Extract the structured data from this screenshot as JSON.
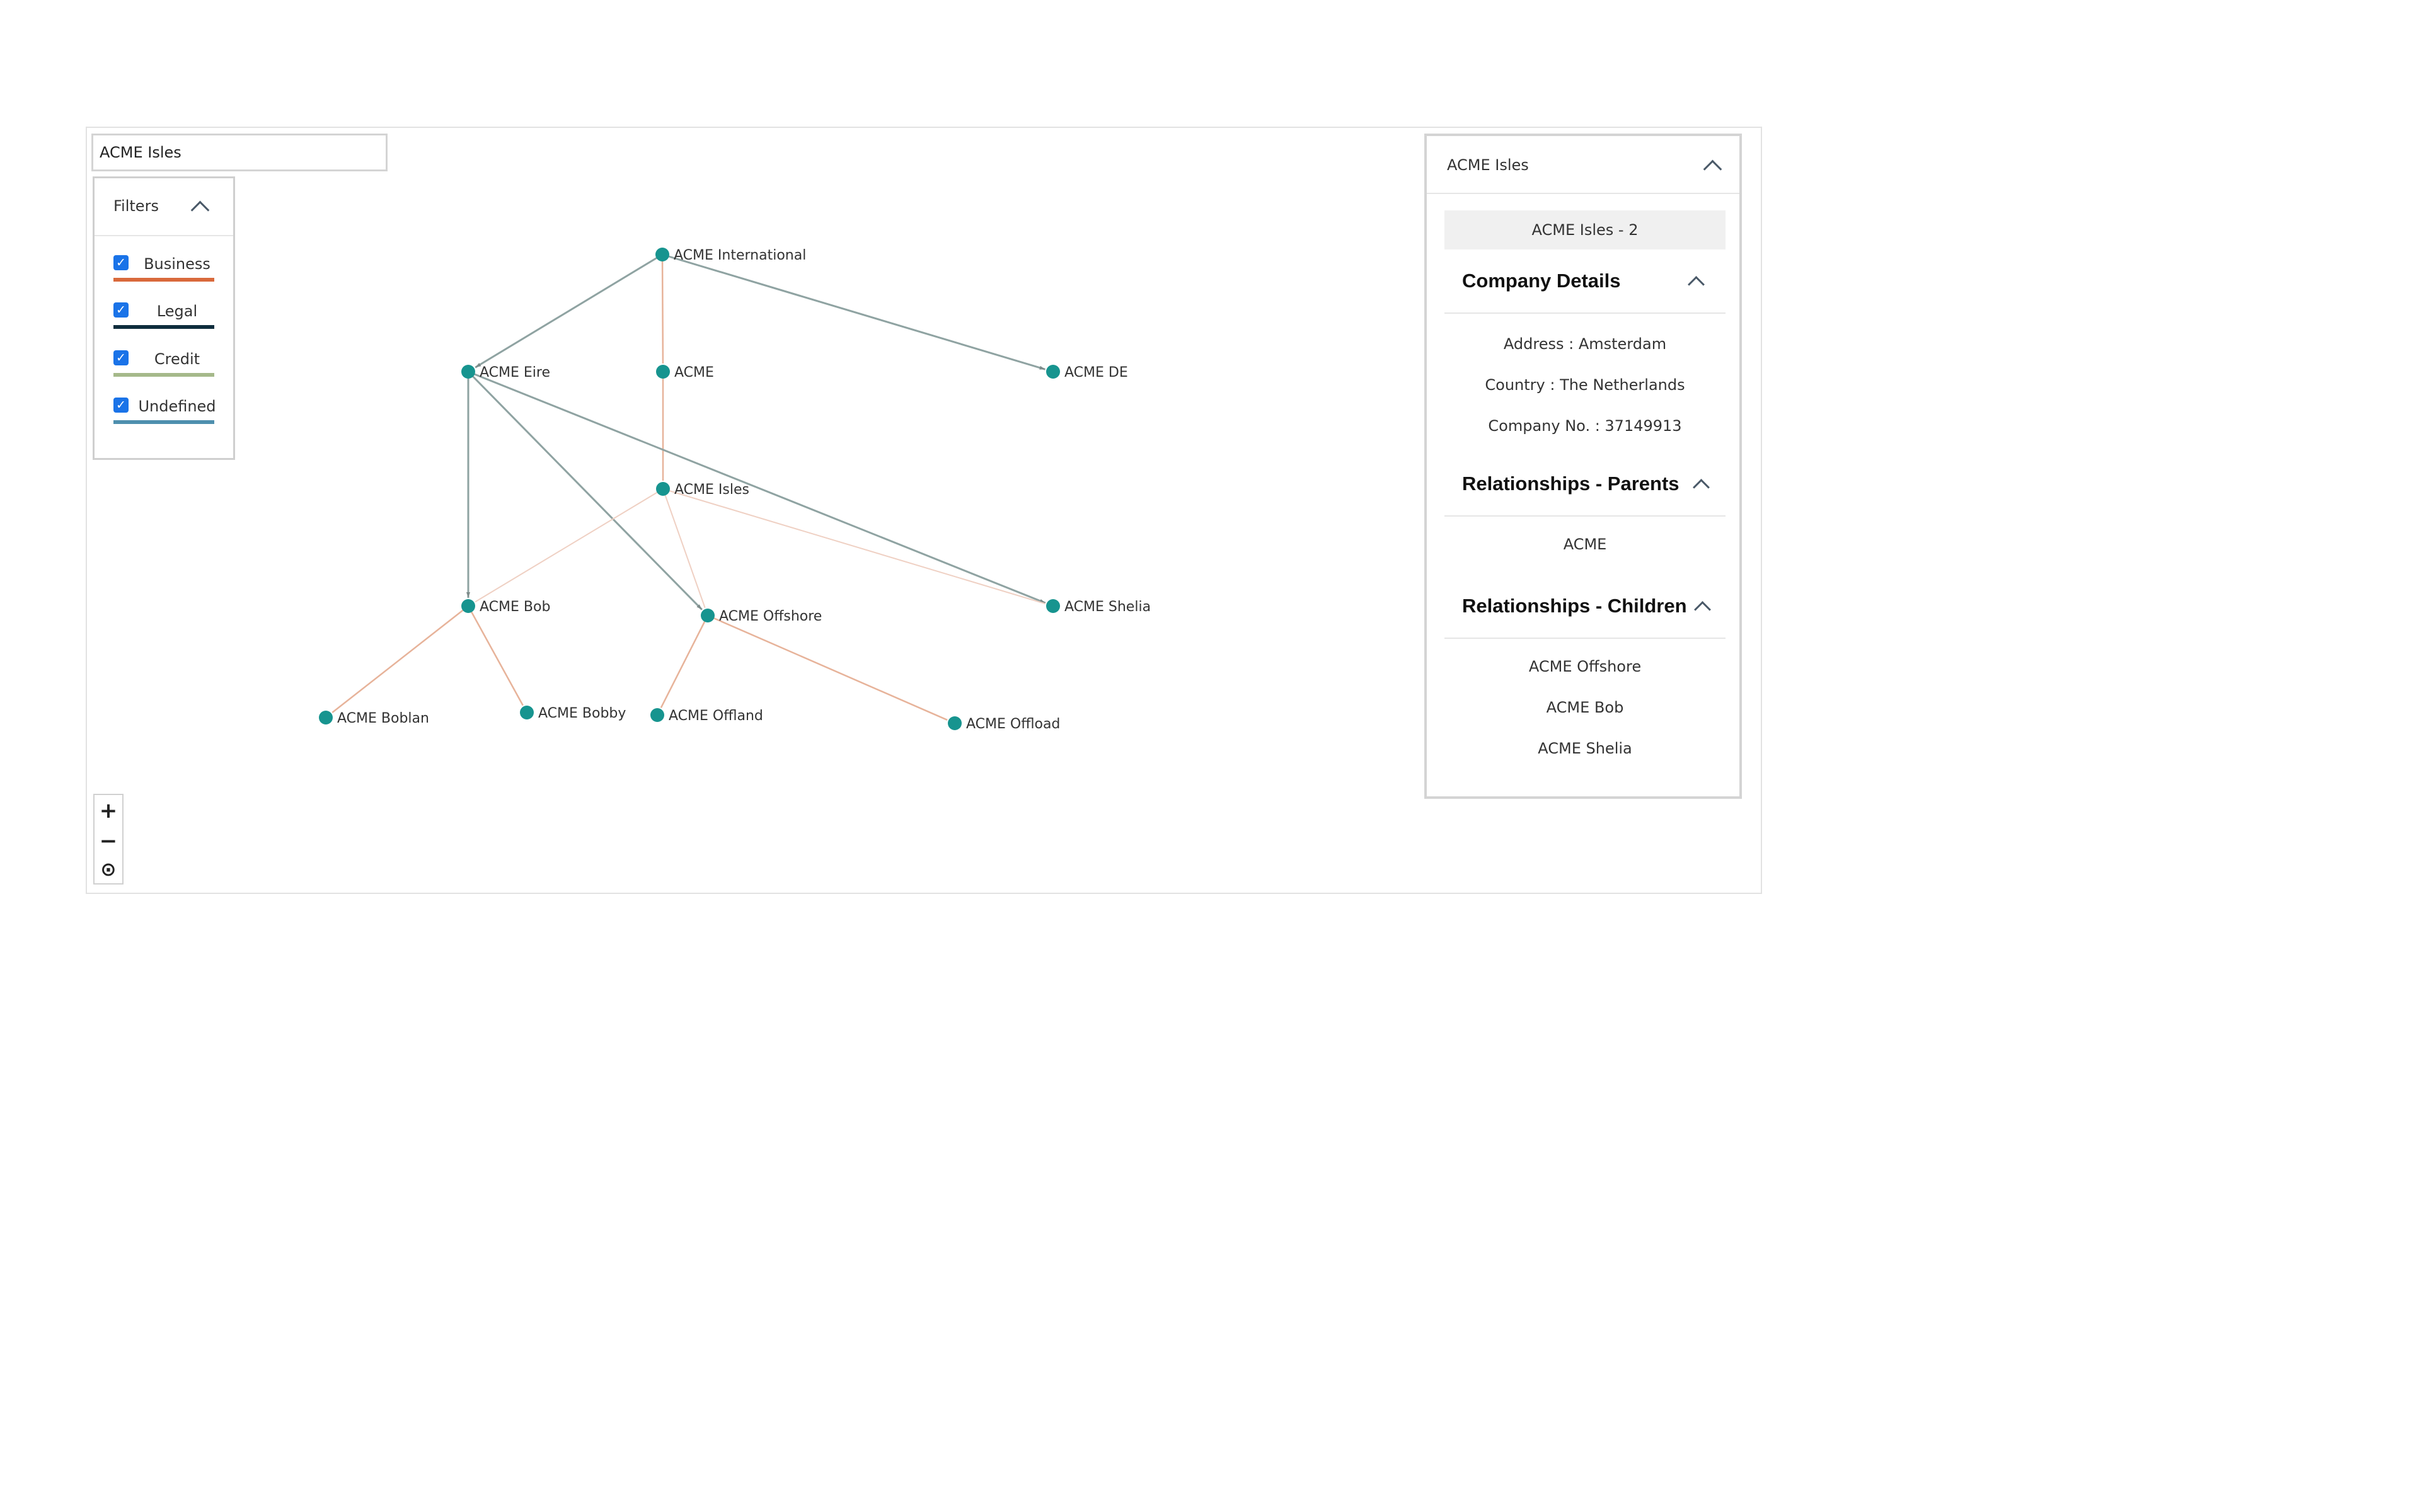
{
  "search": {
    "value": "ACME Isles"
  },
  "filters": {
    "title": "Filters",
    "items": [
      {
        "label": "Business",
        "checked": true,
        "color": "#d9693b"
      },
      {
        "label": "Legal",
        "checked": true,
        "color": "#0f2d3d"
      },
      {
        "label": "Credit",
        "checked": true,
        "color": "#a5b98a"
      },
      {
        "label": "Undefined",
        "checked": true,
        "color": "#4e8fae"
      }
    ]
  },
  "graph": {
    "node_color": "#17948f",
    "nodes": [
      {
        "id": "intl",
        "label": "ACME International"
      },
      {
        "id": "eire",
        "label": "ACME Eire"
      },
      {
        "id": "acme",
        "label": "ACME"
      },
      {
        "id": "de",
        "label": "ACME DE"
      },
      {
        "id": "isles",
        "label": "ACME Isles"
      },
      {
        "id": "bob",
        "label": "ACME Bob"
      },
      {
        "id": "offshore",
        "label": "ACME Offshore"
      },
      {
        "id": "shelia",
        "label": "ACME Shelia"
      },
      {
        "id": "boblan",
        "label": "ACME Boblan"
      },
      {
        "id": "bobby",
        "label": "ACME Bobby"
      },
      {
        "id": "offland",
        "label": "ACME Offland"
      },
      {
        "id": "offload",
        "label": "ACME Offload"
      }
    ],
    "edges": [
      {
        "from": "intl",
        "to": "eire",
        "kind": "undefined"
      },
      {
        "from": "intl",
        "to": "acme",
        "kind": "business"
      },
      {
        "from": "intl",
        "to": "de",
        "kind": "undefined"
      },
      {
        "from": "acme",
        "to": "isles",
        "kind": "business"
      },
      {
        "from": "eire",
        "to": "bob",
        "kind": "undefined"
      },
      {
        "from": "eire",
        "to": "offshore",
        "kind": "undefined"
      },
      {
        "from": "eire",
        "to": "shelia",
        "kind": "undefined"
      },
      {
        "from": "isles",
        "to": "bob",
        "kind": "business-light"
      },
      {
        "from": "isles",
        "to": "offshore",
        "kind": "business-light"
      },
      {
        "from": "isles",
        "to": "shelia",
        "kind": "business-light"
      },
      {
        "from": "bob",
        "to": "boblan",
        "kind": "business"
      },
      {
        "from": "bob",
        "to": "bobby",
        "kind": "business"
      },
      {
        "from": "offshore",
        "to": "offland",
        "kind": "business"
      },
      {
        "from": "offshore",
        "to": "offload",
        "kind": "business"
      }
    ]
  },
  "zoom": {
    "in": "+",
    "out": "−",
    "reset": "⊙"
  },
  "panel": {
    "title": "ACME Isles",
    "subtitle": "ACME Isles - 2",
    "company_details": {
      "title": "Company Details",
      "address": "Address : Amsterdam",
      "country": "Country : The Netherlands",
      "company_no": "Company No. : 37149913"
    },
    "parents": {
      "title": "Relationships - Parents",
      "items": [
        "ACME"
      ]
    },
    "children": {
      "title": "Relationships - Children",
      "items": [
        "ACME Offshore",
        "ACME Bob",
        "ACME Shelia"
      ]
    }
  }
}
